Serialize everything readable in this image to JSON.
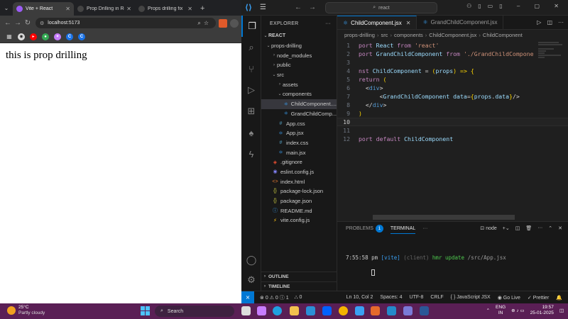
{
  "browser": {
    "tabs": [
      {
        "title": "Vite + React",
        "active": true,
        "icon": "vite-icon",
        "color": "#9c5cf6"
      },
      {
        "title": "Prop Drilling in React",
        "active": false,
        "icon": "ai-icon",
        "color": "#444444"
      },
      {
        "title": "Props drilling fix",
        "active": false,
        "icon": "chatgpt-icon",
        "color": "#444444"
      }
    ],
    "url": "localhost:5173",
    "page_heading": "this is prop drilling"
  },
  "vscode": {
    "search_placeholder": "react",
    "explorer": {
      "header": "EXPLORER",
      "section": "REACT",
      "tree": [
        {
          "label": "props-drilling",
          "depth": 0,
          "kind": "folder-open",
          "selected": false
        },
        {
          "label": "node_modules",
          "depth": 1,
          "kind": "folder",
          "selected": false
        },
        {
          "label": "public",
          "depth": 1,
          "kind": "folder",
          "selected": false
        },
        {
          "label": "src",
          "depth": 1,
          "kind": "folder-open",
          "selected": false
        },
        {
          "label": "assets",
          "depth": 2,
          "kind": "folder",
          "selected": false
        },
        {
          "label": "components",
          "depth": 2,
          "kind": "folder-open",
          "selected": false
        },
        {
          "label": "ChildComponent....",
          "depth": 3,
          "kind": "react",
          "selected": true
        },
        {
          "label": "GrandChildComp...",
          "depth": 3,
          "kind": "react",
          "selected": false
        },
        {
          "label": "App.css",
          "depth": 2,
          "kind": "css",
          "selected": false
        },
        {
          "label": "App.jsx",
          "depth": 2,
          "kind": "react",
          "selected": false
        },
        {
          "label": "index.css",
          "depth": 2,
          "kind": "css",
          "selected": false
        },
        {
          "label": "main.jsx",
          "depth": 2,
          "kind": "react",
          "selected": false
        },
        {
          "label": ".gitignore",
          "depth": 1,
          "kind": "git",
          "selected": false
        },
        {
          "label": "eslint.config.js",
          "depth": 1,
          "kind": "eslint",
          "selected": false
        },
        {
          "label": "index.html",
          "depth": 1,
          "kind": "html",
          "selected": false
        },
        {
          "label": "package-lock.json",
          "depth": 1,
          "kind": "json",
          "selected": false
        },
        {
          "label": "package.json",
          "depth": 1,
          "kind": "json",
          "selected": false
        },
        {
          "label": "README.md",
          "depth": 1,
          "kind": "info",
          "selected": false
        },
        {
          "label": "vite.config.js",
          "depth": 1,
          "kind": "vite",
          "selected": false
        }
      ],
      "outline": "OUTLINE",
      "timeline": "TIMELINE"
    },
    "tabs": [
      {
        "label": "ChildComponent.jsx",
        "active": true
      },
      {
        "label": "GrandChildComponent.jsx",
        "active": false
      }
    ],
    "breadcrumb": [
      "props-drilling",
      "src",
      "components",
      "ChildComponent.jsx",
      "ChildComponent"
    ],
    "code": [
      {
        "n": "1",
        "text": "port React from 'react'"
      },
      {
        "n": "2",
        "text": "port GrandChildComponent from './GrandChildCompone"
      },
      {
        "n": "3",
        "text": ""
      },
      {
        "n": "4",
        "text": "nst ChildComponent = (props) => {"
      },
      {
        "n": "5",
        "text": "return ("
      },
      {
        "n": "6",
        "text": "  <div>"
      },
      {
        "n": "7",
        "text": "      <GrandChildComponent data={props.data}/>"
      },
      {
        "n": "8",
        "text": "  </div>"
      },
      {
        "n": "9",
        "text": ")"
      },
      {
        "n": "10",
        "text": ""
      },
      {
        "n": "11",
        "text": ""
      },
      {
        "n": "12",
        "text": "port default ChildComponent"
      }
    ],
    "current_line": "10",
    "panel": {
      "problems": "PROBLEMS",
      "problems_count": "1",
      "terminal": "TERMINAL",
      "more": "···",
      "shell": "node",
      "terminal_line": "7:55:58 pm [vite] (client) hmr update /src/App.jsx"
    },
    "status": {
      "errors": "0",
      "warnings": "0",
      "info": "1",
      "ports": "0",
      "position": "Ln 10, Col 2",
      "spaces": "Spaces: 4",
      "encoding": "UTF-8",
      "eol": "CRLF",
      "language": "JavaScript JSX",
      "golive": "Go Live",
      "prettier": "Prettier"
    }
  },
  "taskbar": {
    "temp": "25°C",
    "weather": "Partly cloudy",
    "search": "Search",
    "lang1": "ENG",
    "lang2": "IN",
    "time": "19:57",
    "date": "25-01-2025"
  },
  "colors": {
    "accent": "#0078d4",
    "keyword": "#c586c0",
    "string": "#ce9178",
    "variable": "#9cdcfe",
    "type": "#4ec9b0",
    "taskbar": "#5a1f55"
  }
}
